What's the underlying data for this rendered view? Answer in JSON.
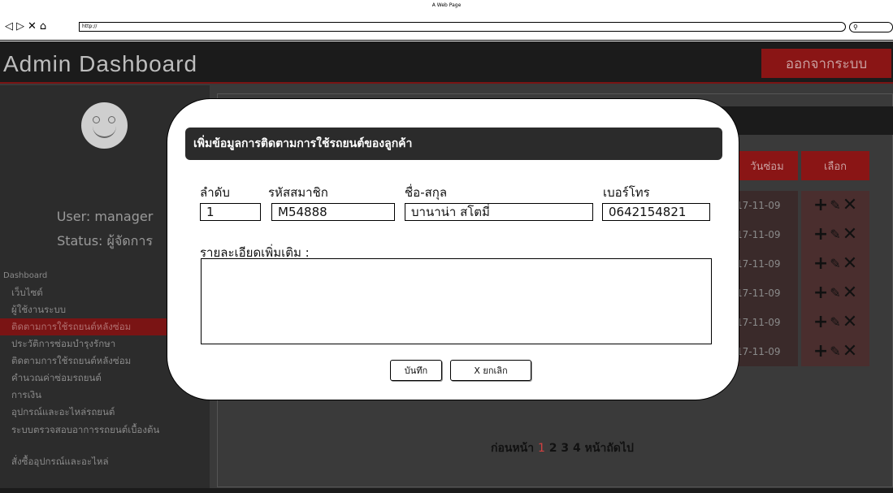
{
  "browser": {
    "page_title": "A Web Page",
    "url": "http://",
    "nav": [
      "◁",
      "▷",
      "✕",
      "⌂"
    ]
  },
  "app": {
    "title": "Admin Dashboard",
    "logout_label": "ออกจากระบบ"
  },
  "sidebar": {
    "user_line": "User: manager",
    "status_line": "Status: ผู้จัดการ",
    "section": "Dashboard",
    "items": [
      {
        "label": "เว็บไซต์"
      },
      {
        "label": "ผู้ใช้งานระบบ"
      },
      {
        "label": "ติดตามการใช้รถยนต์หลังซ่อม"
      },
      {
        "label": "ประวัติการซ่อมบำรุงรักษา"
      },
      {
        "label": "ติดตามการใช้รถยนต์หลังซ่อม"
      },
      {
        "label": "คำนวณค่าซ่อมรถยนต์"
      },
      {
        "label": "การเงิน"
      },
      {
        "label": "อุปกรณ์และอะไหล่รถยนต์"
      },
      {
        "label": "ระบบตรวจสอบอาการรถยนต์เบื้องต้น"
      },
      {
        "label": "สั่งซื้ออุปกรณ์และอะไหล่"
      }
    ]
  },
  "table": {
    "headers": [
      "วันซ่อม",
      "เลือก"
    ],
    "dates": [
      "17-11-09",
      "17-11-09",
      "17-11-09",
      "17-11-09",
      "17-11-09",
      "17-11-09"
    ],
    "actions": {
      "add": "+",
      "edit": "✎",
      "delete": "✕"
    }
  },
  "pager": {
    "prev": "ก่อนหน้า",
    "pages": [
      "1",
      "2",
      "3",
      "4"
    ],
    "current": "1",
    "next": "หน้าถัดไป"
  },
  "modal": {
    "title": "เพิ่มข้อมูลการติดตามการใช้รถยนต์ของลูกค้า",
    "labels": {
      "order": "ลำดับ",
      "member_id": "รหัสสมาชิก",
      "name": "ชื่อ-สกุล",
      "phone": "เบอร์โทร",
      "details": "รายละเอียดเพิ่มเติม :"
    },
    "values": {
      "order": "1",
      "member_id": "M54888",
      "name": "บานาน่า สโตมี่",
      "phone": "0642154821",
      "details": ""
    },
    "save_label": "บันทึก",
    "cancel_label": "X ยกเลิก"
  }
}
